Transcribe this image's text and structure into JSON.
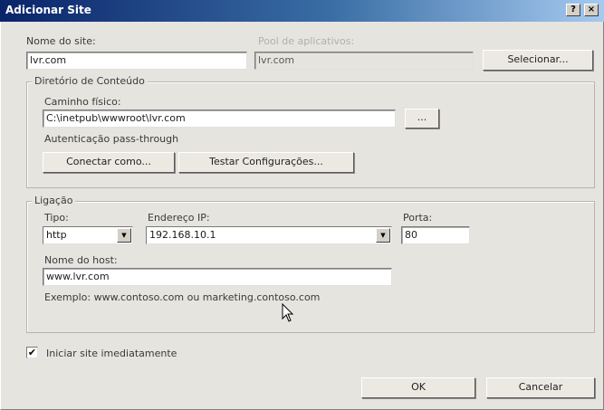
{
  "window": {
    "title": "Adicionar Site",
    "help_label": "?",
    "close_label": "×"
  },
  "site": {
    "name_label": "Nome do site:",
    "name_value": "lvr.com",
    "pool_label": "Pool de aplicativos:",
    "pool_value": "lvr.com",
    "select_button": "Selecionar..."
  },
  "content_dir": {
    "group_title": "Diretório de Conteúdo",
    "path_label": "Caminho físico:",
    "path_value": "C:\\inetpub\\wwwroot\\lvr.com",
    "browse_button": "...",
    "auth_text": "Autenticação pass-through",
    "connect_button": "Conectar como...",
    "test_button": "Testar Configurações..."
  },
  "binding": {
    "group_title": "Ligação",
    "type_label": "Tipo:",
    "type_value": "http",
    "ip_label": "Endereço IP:",
    "ip_value": "192.168.10.1",
    "port_label": "Porta:",
    "port_value": "80",
    "host_label": "Nome do host:",
    "host_value": "www.lvr.com",
    "example_text": "Exemplo: www.contoso.com ou marketing.contoso.com"
  },
  "start": {
    "checked": true,
    "mark": "✔",
    "label": "Iniciar site imediatamente"
  },
  "footer": {
    "ok_button": "OK",
    "cancel_button": "Cancelar"
  },
  "icons": {
    "dropdown": "chevron-down-icon",
    "cursor": "mouse-pointer-icon"
  }
}
